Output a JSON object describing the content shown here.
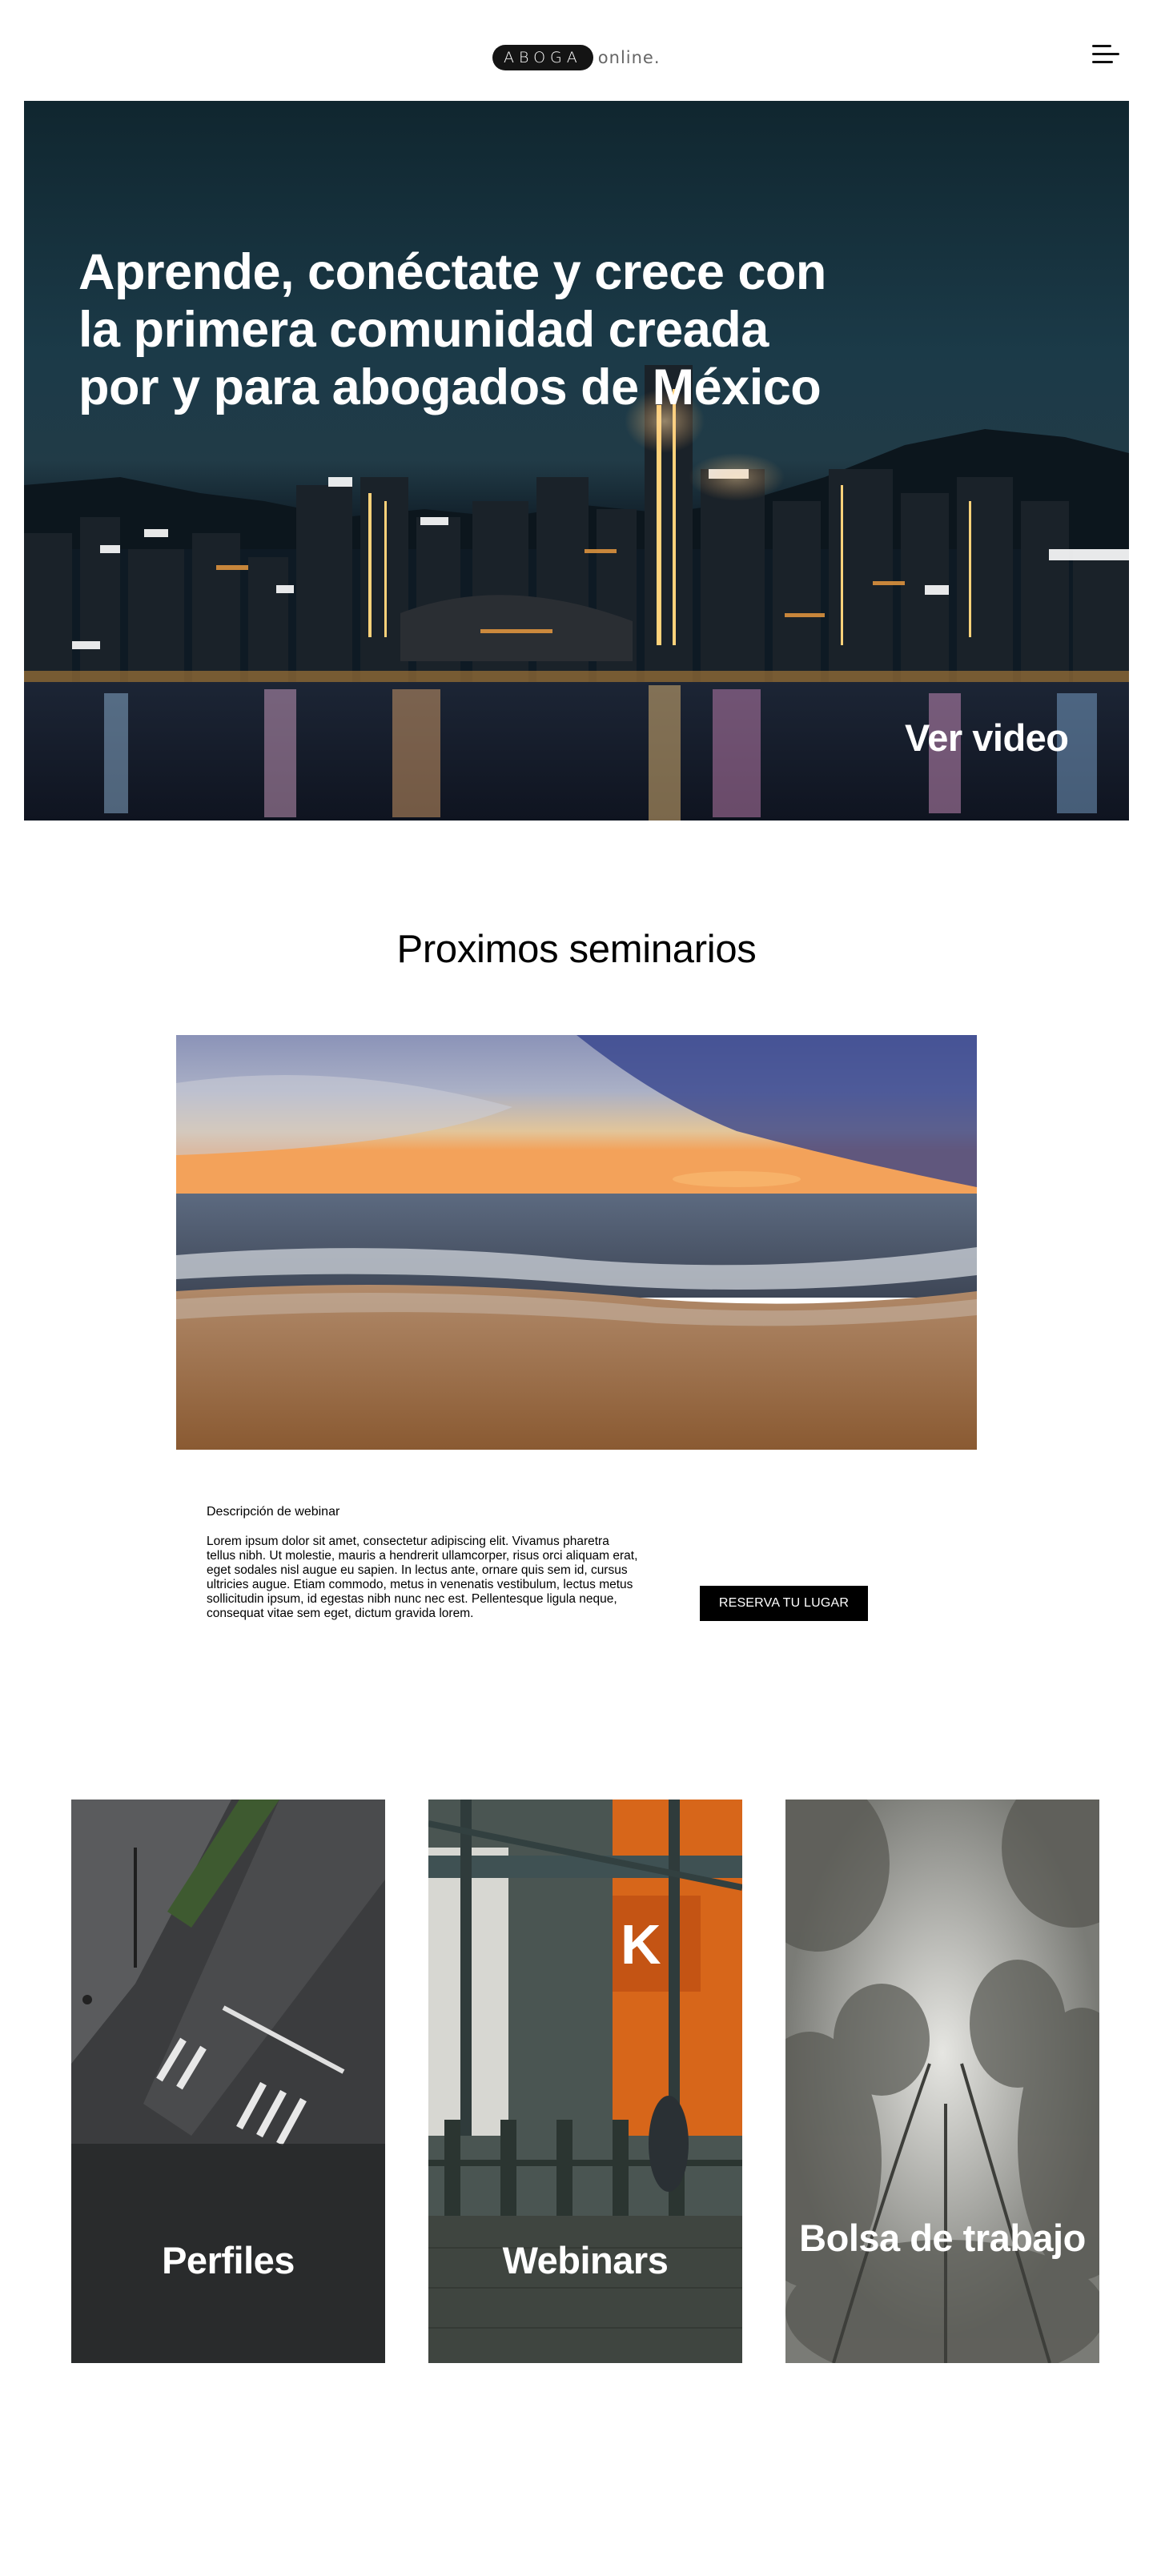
{
  "header": {
    "logo_main": "ABOGA",
    "logo_suffix": "online.",
    "menu_icon": "hamburger-menu-icon"
  },
  "hero": {
    "title": "Aprende, conéctate y crece con la primera comunidad creada por y para abogados de México",
    "video_link": "Ver video",
    "image": "night-city-skyline-harbor"
  },
  "seminars": {
    "title": "Proximos seminarios",
    "image": "beach-sunset-ocean",
    "description_title": "Descripción de webinar",
    "description_body": "Lorem ipsum dolor sit amet, consectetur adipiscing elit. Vivamus pharetra tellus nibh. Ut molestie, mauris a hendrerit ullamcorper, risus orci aliquam erat, eget sodales nisl augue eu sapien. In lectus ante, ornare quis sem id, cursus ultricies augue. Etiam commodo, metus in venenatis vestibulum, lectus metus sollicitudin ipsum, id egestas nibh nunc nec est. Pellentesque ligula neque, consequat vitae sem eget, dictum gravida lorem.",
    "cta_label": "RESERVA TU LUGAR"
  },
  "cards": [
    {
      "label": "Perfiles",
      "image": "aerial-street-crosswalk"
    },
    {
      "label": "Webinars",
      "image": "industrial-crane-harbor"
    },
    {
      "label": "Bolsa de trabajo",
      "image": "foggy-forest-canopy"
    }
  ],
  "colors": {
    "background": "#ffffff",
    "text": "#000000",
    "button_bg": "#000000",
    "button_text": "#ffffff"
  }
}
